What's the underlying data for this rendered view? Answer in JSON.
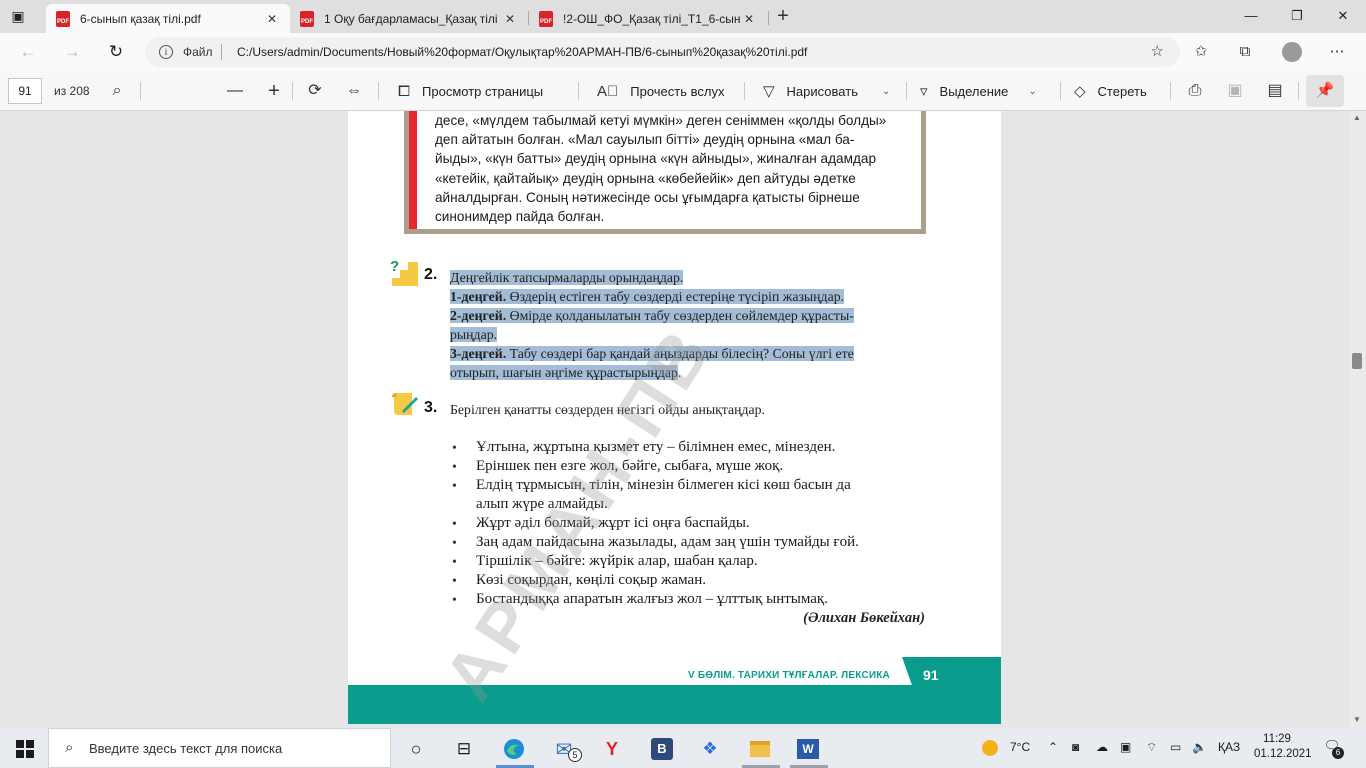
{
  "tabs": [
    {
      "title": "6-сынып қазақ тілі.pdf",
      "icon": "pdf-icon",
      "active": true
    },
    {
      "title": "1 Оқу бағдарламасы_Қазақ тілі",
      "icon": "pdf-icon",
      "active": false
    },
    {
      "title": "!2-ОШ_ФО_Қазақ тілі_Т1_6-сын.",
      "icon": "pdf-icon",
      "active": false
    }
  ],
  "pdf_icon_text": "PDF",
  "address": {
    "file_label": "Файл",
    "url": "C:/Users/admin/Documents/Новый%20формат/Оқулықтар%20АРМАН-ПВ/6-сынып%20қазақ%20тілі.pdf"
  },
  "pdf_toolbar": {
    "page_current": "91",
    "page_total": "из 208",
    "page_view": "Просмотр страницы",
    "read_aloud": "Прочесть вслух",
    "draw": "Нарисовать",
    "highlight": "Выделение",
    "erase": "Стереть"
  },
  "document": {
    "story_lines": [
      "десе, «мүлдем табылмай кетуі мүмкін» деген сеніммен «қолды болды»",
      "деп айтатын болған. «Мал сауылып бітті» деудің орнына «мал ба-",
      "йыды», «күн батты» деудің орнына «күн айныды», жиналған адамдар",
      "«кетейік, қайтайық» деудің  орнына «көбейейік» деп айтуды әдетке",
      "айналдырған. Соның нәтижесінде осы ұғымдарға қатысты бірнеше",
      "синонимдер пайда болған."
    ],
    "task2": {
      "number": "2.",
      "heading": "Деңгейлік тапсырмаларды орындаңдар.",
      "level1_label": "1-деңгей.",
      "level1_text": " Өздерің естіген табу сөздерді естеріңе түсіріп жазыңдар.",
      "level2_label": "2-деңгей.",
      "level2_text": " Өмірде қолданылатын табу сөздерден сөйлемдер құрасты-",
      "level2_cont": "рыңдар.",
      "level3_label": "3-деңгей.",
      "level3_text": " Табу сөздері бар қандай аңыздарды білесің? Соны үлгі ете",
      "level3_cont": "отырып, шағын әңгіме құрастырыңдар",
      "level3_end": "."
    },
    "task3": {
      "number": "3.",
      "heading": "Берілген қанатты сөздерден негізгі ойды анықтаңдар.",
      "bullet": "•",
      "proverbs": [
        "Ұлтына, жұртына қызмет ету – білімнен емес, мінезден.",
        "Еріншек пен езге жол, бәйге, сыбаға, мүше жоқ.",
        "Елдің тұрмысын, тілін, мінезін білмеген кісі көш басын да",
        "алып жүре алмайды.",
        "Жұрт әділ болмай, жұрт ісі оңға баспайды.",
        "Заң адам пайдасына жазылады, адам заң үшін тумайды ғой.",
        "Тіршілік – бәйге: жүйрік алар, шабан қалар.",
        "Көзі соқырдан, көңілі соқыр жаман.",
        "Бостандыққа апаратын жалғыз жол – ұлттық ынтымақ."
      ],
      "author": "(Әлихан Бөкейхан)"
    },
    "footer_section": "V БӨЛІМ. ТАРИХИ ТҰЛҒАЛАР. ЛЕКСИКА",
    "page_number": "91",
    "watermark": "АРМАН-ПВ"
  },
  "taskbar": {
    "search_placeholder": "Введите здесь текст для поиска",
    "mail_badge": "5",
    "weather": "7°C",
    "lang": "ҚАЗ",
    "time": "11:29",
    "date": "01.12.2021",
    "notifications": "6"
  }
}
